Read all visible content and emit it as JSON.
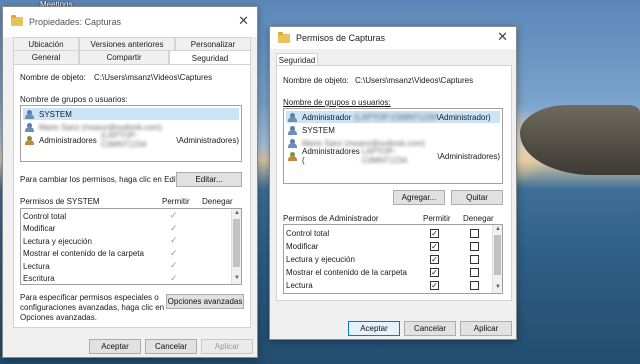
{
  "desktop": {
    "label": "Meetings"
  },
  "props_window": {
    "title": "Propiedades: Capturas",
    "tabs_row1": [
      "Ubicación",
      "Versiones anteriores",
      "Personalizar"
    ],
    "tabs_row2": [
      "General",
      "Compartir",
      "Seguridad"
    ],
    "object_label": "Nombre de objeto:",
    "object_value": "C:\\Users\\msanz\\Videos\\Captures",
    "groups_label": "Nombre de grupos o usuarios:",
    "groups": [
      "SYSTEM",
      "Mario Sanz (msanz@outlook.com)",
      "Administradores",
      "(LAPTOP-C0MNT1234",
      "\\Administradores)"
    ],
    "edit_hint": "Para cambiar los permisos, haga clic en Editar.",
    "edit_button": "Editar...",
    "perm_header": "Permisos de SYSTEM",
    "perm_allow": "Permitir",
    "perm_deny": "Denegar",
    "permissions": [
      "Control total",
      "Modificar",
      "Lectura y ejecución",
      "Mostrar el contenido de la carpeta",
      "Lectura",
      "Escritura"
    ],
    "special_hint_1": "Para especificar permisos especiales o",
    "special_hint_2": "configuraciones avanzadas, haga clic en",
    "special_hint_3": "Opciones avanzadas.",
    "advanced_button": "Opciones avanzadas",
    "ok": "Aceptar",
    "cancel": "Cancelar",
    "apply": "Aplicar"
  },
  "perm_window": {
    "title": "Permisos de Capturas",
    "tab": "Seguridad",
    "object_label": "Nombre de objeto:",
    "object_value": "C:\\Users\\msanz\\Videos\\Captures",
    "groups_label": "Nombre de grupos o usuarios:",
    "groups": [
      "Administrador",
      "(LAPTOP-C0MNT1234",
      "\\Administrador)",
      "SYSTEM",
      "Mario Sanz (msanz@outlook.com)",
      "Administradores (",
      "LAPTOP-C0MNT1234",
      "\\Administradores)"
    ],
    "add_button": "Agregar...",
    "remove_button": "Quitar",
    "perm_header": "Permisos de Administrador",
    "perm_allow": "Permitir",
    "perm_deny": "Denegar",
    "permissions": [
      "Control total",
      "Modificar",
      "Lectura y ejecución",
      "Mostrar el contenido de la carpeta",
      "Lectura"
    ],
    "allow_checked": [
      "✓",
      "✓",
      "✓",
      "✓",
      "✓"
    ],
    "ok": "Aceptar",
    "cancel": "Cancelar",
    "apply": "Aplicar"
  },
  "icons": [
    "folder-icon",
    "close-icon",
    "user-icon",
    "group-icon",
    "check-icon",
    "scroll-up-icon",
    "scroll-down-icon"
  ]
}
